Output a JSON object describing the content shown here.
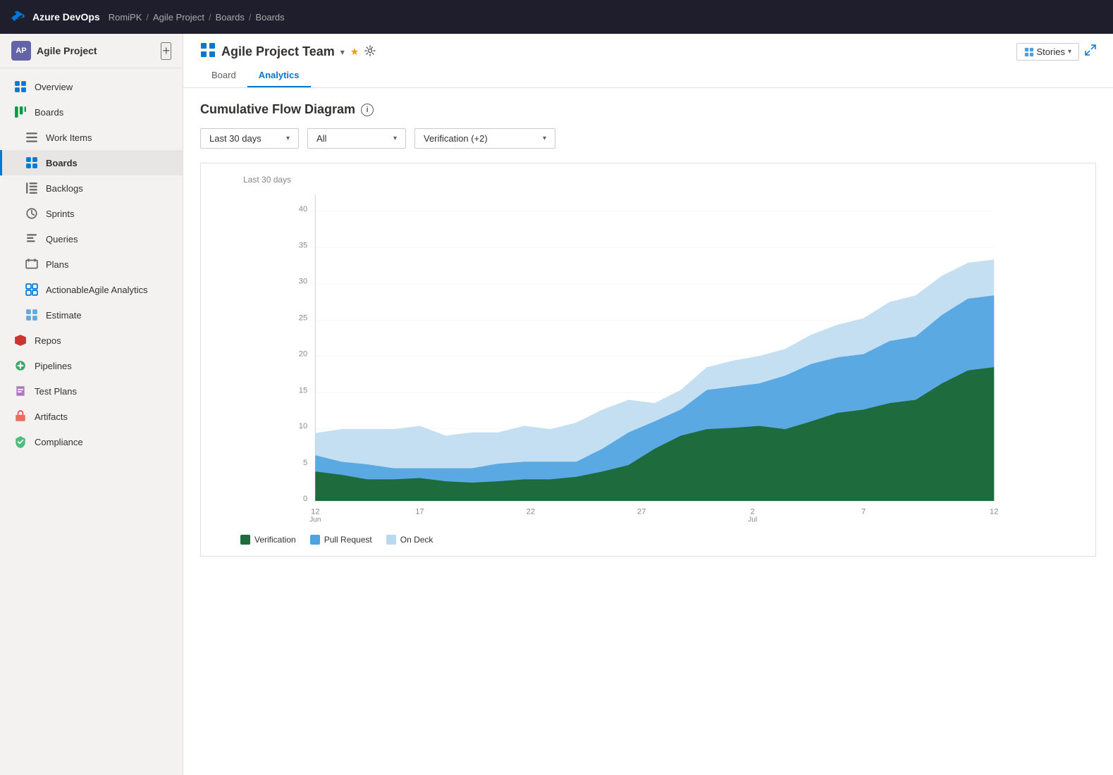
{
  "topbar": {
    "logo_text": "Azure DevOps",
    "breadcrumbs": [
      "RomiPK",
      "Agile Project",
      "Boards",
      "Boards"
    ],
    "seps": [
      "/",
      "/",
      "/"
    ]
  },
  "sidebar": {
    "project_name": "Agile Project",
    "avatar_text": "AP",
    "nav_items": [
      {
        "id": "overview",
        "label": "Overview",
        "icon": "overview"
      },
      {
        "id": "boards",
        "label": "Boards",
        "icon": "boards",
        "active": false
      },
      {
        "id": "work-items",
        "label": "Work Items",
        "icon": "work-items"
      },
      {
        "id": "boards-sub",
        "label": "Boards",
        "icon": "boards-grid",
        "active": true
      },
      {
        "id": "backlogs",
        "label": "Backlogs",
        "icon": "backlogs"
      },
      {
        "id": "sprints",
        "label": "Sprints",
        "icon": "sprints"
      },
      {
        "id": "queries",
        "label": "Queries",
        "icon": "queries"
      },
      {
        "id": "plans",
        "label": "Plans",
        "icon": "plans"
      },
      {
        "id": "actionable",
        "label": "ActionableAgile Analytics",
        "icon": "actionable"
      },
      {
        "id": "estimate",
        "label": "Estimate",
        "icon": "estimate"
      },
      {
        "id": "repos",
        "label": "Repos",
        "icon": "repos"
      },
      {
        "id": "pipelines",
        "label": "Pipelines",
        "icon": "pipelines"
      },
      {
        "id": "test-plans",
        "label": "Test Plans",
        "icon": "test-plans"
      },
      {
        "id": "artifacts",
        "label": "Artifacts",
        "icon": "artifacts"
      },
      {
        "id": "compliance",
        "label": "Compliance",
        "icon": "compliance"
      }
    ]
  },
  "page": {
    "team_icon": "📋",
    "team_name": "Agile Project Team",
    "tabs": [
      {
        "id": "board",
        "label": "Board"
      },
      {
        "id": "analytics",
        "label": "Analytics",
        "active": true
      }
    ],
    "stories_label": "Stories",
    "chart_title": "Cumulative Flow Diagram",
    "period_label": "Last 30 days",
    "filters": [
      {
        "id": "date-range",
        "value": "Last 30 days"
      },
      {
        "id": "type",
        "value": "All"
      },
      {
        "id": "states",
        "value": "Verification (+2)"
      }
    ],
    "legend": [
      {
        "label": "Verification",
        "color": "#1e6b3e"
      },
      {
        "label": "Pull Request",
        "color": "#4fa3e0"
      },
      {
        "label": "On Deck",
        "color": "#b8d9ef"
      }
    ],
    "chart": {
      "y_labels": [
        "0",
        "5",
        "10",
        "15",
        "20",
        "25",
        "30",
        "35",
        "40"
      ],
      "x_labels": [
        "12\nJun",
        "17",
        "22",
        "27",
        "2\nJul",
        "7",
        "12"
      ],
      "y_min": 0,
      "y_max": 45
    }
  }
}
